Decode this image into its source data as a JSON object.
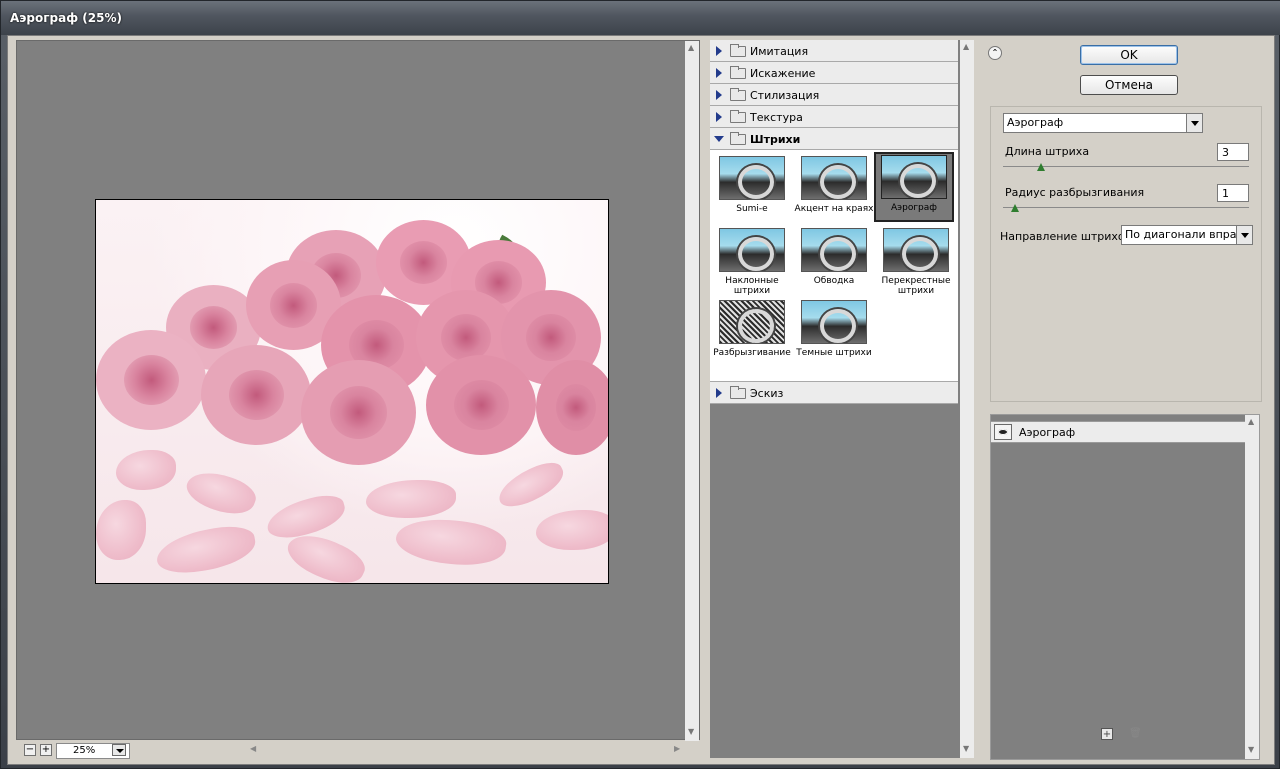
{
  "window": {
    "title": "Аэрограф (25%)"
  },
  "zoom": {
    "minus": "−",
    "plus": "+",
    "value": "25%"
  },
  "categories": [
    {
      "label": "Имитация",
      "open": false
    },
    {
      "label": "Искажение",
      "open": false
    },
    {
      "label": "Стилизация",
      "open": false
    },
    {
      "label": "Текстура",
      "open": false
    },
    {
      "label": "Штрихи",
      "open": true
    },
    {
      "label": "Эскиз",
      "open": false
    }
  ],
  "stroke_filters": [
    {
      "label": "Sumi-e"
    },
    {
      "label": "Акцент на краях"
    },
    {
      "label": "Аэрограф",
      "selected": true
    },
    {
      "label": "Наклонные штрихи"
    },
    {
      "label": "Обводка"
    },
    {
      "label": "Перекрестные штрихи"
    },
    {
      "label": "Разбрызгивание"
    },
    {
      "label": "Темные штрихи"
    }
  ],
  "buttons": {
    "ok": "OK",
    "cancel": "Отмена",
    "collapse": "⌃"
  },
  "settings": {
    "filter_select": "Аэрограф",
    "stroke_length": {
      "label": "Длина штриха",
      "value": "3",
      "fraction": 0.05
    },
    "spray_radius": {
      "label": "Радиус разбрызгивания",
      "value": "1",
      "fraction": 0.02
    },
    "direction": {
      "label": "Направление штрихов:",
      "value": "По диагонали вправо"
    }
  },
  "layers": [
    {
      "label": "Аэрограф",
      "visible": true
    }
  ],
  "layer_buttons": {
    "new": "+",
    "delete": "🗑"
  },
  "scroll": {
    "up": "▲",
    "down": "▼",
    "left": "◀",
    "right": "▶"
  },
  "colors": {
    "frame": "#4f555e",
    "panel": "#d4d0c8",
    "canvas": "#808080",
    "ok_border": "#3a6ea5"
  }
}
